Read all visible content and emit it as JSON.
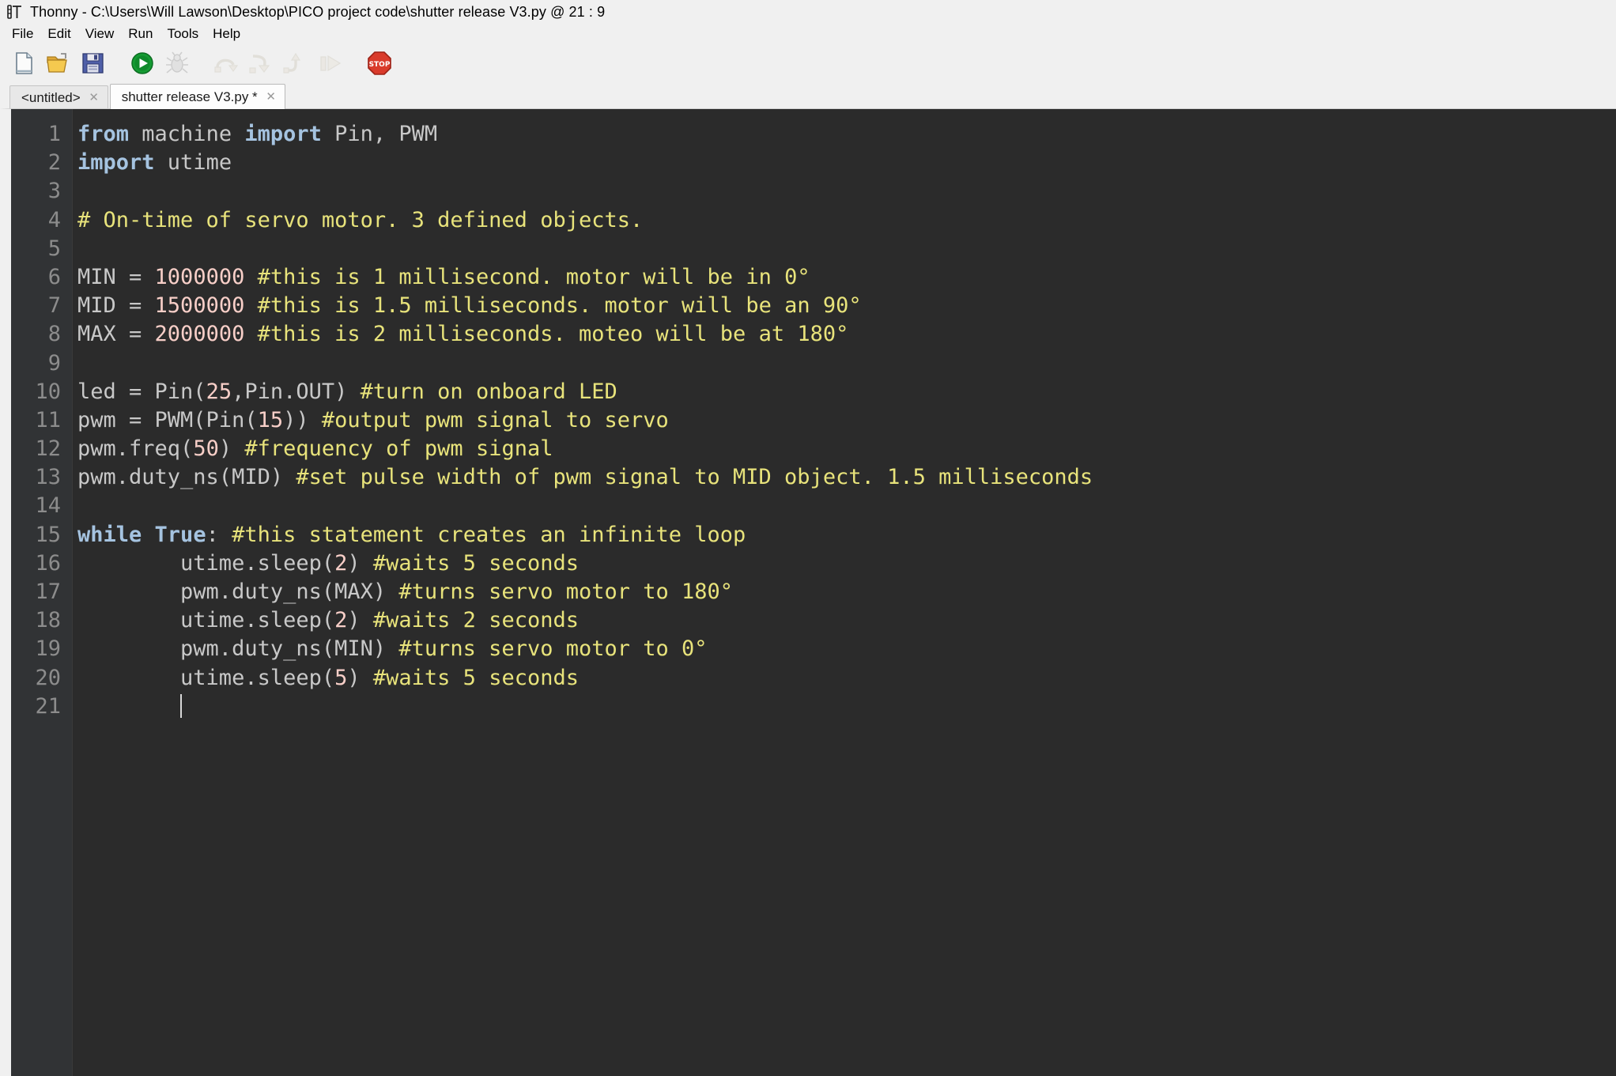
{
  "window": {
    "app_name": "Thonny",
    "separator": "-",
    "file_path": "C:\\Users\\Will Lawson\\Desktop\\PICO project code\\shutter release V3.py",
    "position_marker": "@",
    "cursor_position": "21 : 9",
    "title_full": "Thonny  -  C:\\Users\\Will Lawson\\Desktop\\PICO project code\\shutter release V3.py  @  21 : 9",
    "logo_icon": "thonny-logo-icon"
  },
  "menubar": {
    "items": [
      {
        "label": "File"
      },
      {
        "label": "Edit"
      },
      {
        "label": "View"
      },
      {
        "label": "Run"
      },
      {
        "label": "Tools"
      },
      {
        "label": "Help"
      }
    ]
  },
  "toolbar": {
    "buttons": [
      {
        "name": "new-file-icon",
        "label": "New",
        "enabled": true
      },
      {
        "name": "open-folder-icon",
        "label": "Load",
        "enabled": true
      },
      {
        "name": "save-icon",
        "label": "Save",
        "enabled": true
      },
      {
        "name": "run-icon",
        "label": "Run",
        "enabled": true
      },
      {
        "name": "debug-bug-icon",
        "label": "Debug",
        "enabled": false
      },
      {
        "name": "step-over-icon",
        "label": "Step over",
        "enabled": false
      },
      {
        "name": "step-into-icon",
        "label": "Step into",
        "enabled": false
      },
      {
        "name": "step-out-icon",
        "label": "Step out",
        "enabled": false
      },
      {
        "name": "resume-icon",
        "label": "Resume",
        "enabled": false
      },
      {
        "name": "stop-icon",
        "label": "Stop",
        "enabled": true
      }
    ]
  },
  "tabs": [
    {
      "label": "<untitled>",
      "active": false,
      "close_glyph": "✕"
    },
    {
      "label": "shutter release V3.py *",
      "active": true,
      "close_glyph": "✕"
    }
  ],
  "editor": {
    "colors": {
      "background": "#2b2b2b",
      "gutter_background": "#313335",
      "line_number": "#8c8c8c",
      "default_text": "#c8c8c8",
      "keyword": "#a5c3e0",
      "comment": "#e8e37b",
      "number": "#f8cfc8",
      "caret": "#d8d8d8"
    },
    "line_numbers": [
      1,
      2,
      3,
      4,
      5,
      6,
      7,
      8,
      9,
      10,
      11,
      12,
      13,
      14,
      15,
      16,
      17,
      18,
      19,
      20,
      21
    ],
    "lines": [
      {
        "n": 1,
        "tokens": [
          {
            "t": "kw",
            "v": "from"
          },
          {
            "t": "plain",
            "v": " machine "
          },
          {
            "t": "kw",
            "v": "import"
          },
          {
            "t": "plain",
            "v": " Pin, PWM"
          }
        ]
      },
      {
        "n": 2,
        "tokens": [
          {
            "t": "kw",
            "v": "import"
          },
          {
            "t": "plain",
            "v": " utime"
          }
        ]
      },
      {
        "n": 3,
        "tokens": []
      },
      {
        "n": 4,
        "tokens": [
          {
            "t": "cmt",
            "v": "# On-time of servo motor. 3 defined objects."
          }
        ]
      },
      {
        "n": 5,
        "tokens": []
      },
      {
        "n": 6,
        "tokens": [
          {
            "t": "plain",
            "v": "MIN = "
          },
          {
            "t": "num",
            "v": "1000000"
          },
          {
            "t": "plain",
            "v": " "
          },
          {
            "t": "cmt",
            "v": "#this is 1 millisecond. motor will be in 0°"
          }
        ]
      },
      {
        "n": 7,
        "tokens": [
          {
            "t": "plain",
            "v": "MID = "
          },
          {
            "t": "num",
            "v": "1500000"
          },
          {
            "t": "plain",
            "v": " "
          },
          {
            "t": "cmt",
            "v": "#this is 1.5 milliseconds. motor will be an 90°"
          }
        ]
      },
      {
        "n": 8,
        "tokens": [
          {
            "t": "plain",
            "v": "MAX = "
          },
          {
            "t": "num",
            "v": "2000000"
          },
          {
            "t": "plain",
            "v": " "
          },
          {
            "t": "cmt",
            "v": "#this is 2 milliseconds. moteo will be at 180°"
          }
        ]
      },
      {
        "n": 9,
        "tokens": []
      },
      {
        "n": 10,
        "tokens": [
          {
            "t": "plain",
            "v": "led = Pin("
          },
          {
            "t": "num",
            "v": "25"
          },
          {
            "t": "plain",
            "v": ",Pin.OUT) "
          },
          {
            "t": "cmt",
            "v": "#turn on onboard LED"
          }
        ]
      },
      {
        "n": 11,
        "tokens": [
          {
            "t": "plain",
            "v": "pwm = PWM(Pin("
          },
          {
            "t": "num",
            "v": "15"
          },
          {
            "t": "plain",
            "v": ")) "
          },
          {
            "t": "cmt",
            "v": "#output pwm signal to servo"
          }
        ]
      },
      {
        "n": 12,
        "tokens": [
          {
            "t": "plain",
            "v": "pwm.freq("
          },
          {
            "t": "num",
            "v": "50"
          },
          {
            "t": "plain",
            "v": ") "
          },
          {
            "t": "cmt",
            "v": "#frequency of pwm signal"
          }
        ]
      },
      {
        "n": 13,
        "tokens": [
          {
            "t": "plain",
            "v": "pwm.duty_ns(MID) "
          },
          {
            "t": "cmt",
            "v": "#set pulse width of pwm signal to MID object. 1.5 milliseconds"
          }
        ]
      },
      {
        "n": 14,
        "tokens": []
      },
      {
        "n": 15,
        "tokens": [
          {
            "t": "kw",
            "v": "while"
          },
          {
            "t": "plain",
            "v": " "
          },
          {
            "t": "kw",
            "v": "True"
          },
          {
            "t": "plain",
            "v": ": "
          },
          {
            "t": "cmt",
            "v": "#this statement creates an infinite loop"
          }
        ]
      },
      {
        "n": 16,
        "tokens": [
          {
            "t": "plain",
            "v": "        utime.sleep("
          },
          {
            "t": "num",
            "v": "2"
          },
          {
            "t": "plain",
            "v": ") "
          },
          {
            "t": "cmt",
            "v": "#waits 5 seconds"
          }
        ]
      },
      {
        "n": 17,
        "tokens": [
          {
            "t": "plain",
            "v": "        pwm.duty_ns(MAX) "
          },
          {
            "t": "cmt",
            "v": "#turns servo motor to 180°"
          }
        ]
      },
      {
        "n": 18,
        "tokens": [
          {
            "t": "plain",
            "v": "        utime.sleep("
          },
          {
            "t": "num",
            "v": "2"
          },
          {
            "t": "plain",
            "v": ") "
          },
          {
            "t": "cmt",
            "v": "#waits 2 seconds"
          }
        ]
      },
      {
        "n": 19,
        "tokens": [
          {
            "t": "plain",
            "v": "        pwm.duty_ns(MIN) "
          },
          {
            "t": "cmt",
            "v": "#turns servo motor to 0°"
          }
        ]
      },
      {
        "n": 20,
        "tokens": [
          {
            "t": "plain",
            "v": "        utime.sleep("
          },
          {
            "t": "num",
            "v": "5"
          },
          {
            "t": "plain",
            "v": ") "
          },
          {
            "t": "cmt",
            "v": "#waits 5 seconds"
          }
        ]
      },
      {
        "n": 21,
        "tokens": [
          {
            "t": "plain",
            "v": "        "
          },
          {
            "t": "caret",
            "v": ""
          }
        ]
      }
    ]
  }
}
